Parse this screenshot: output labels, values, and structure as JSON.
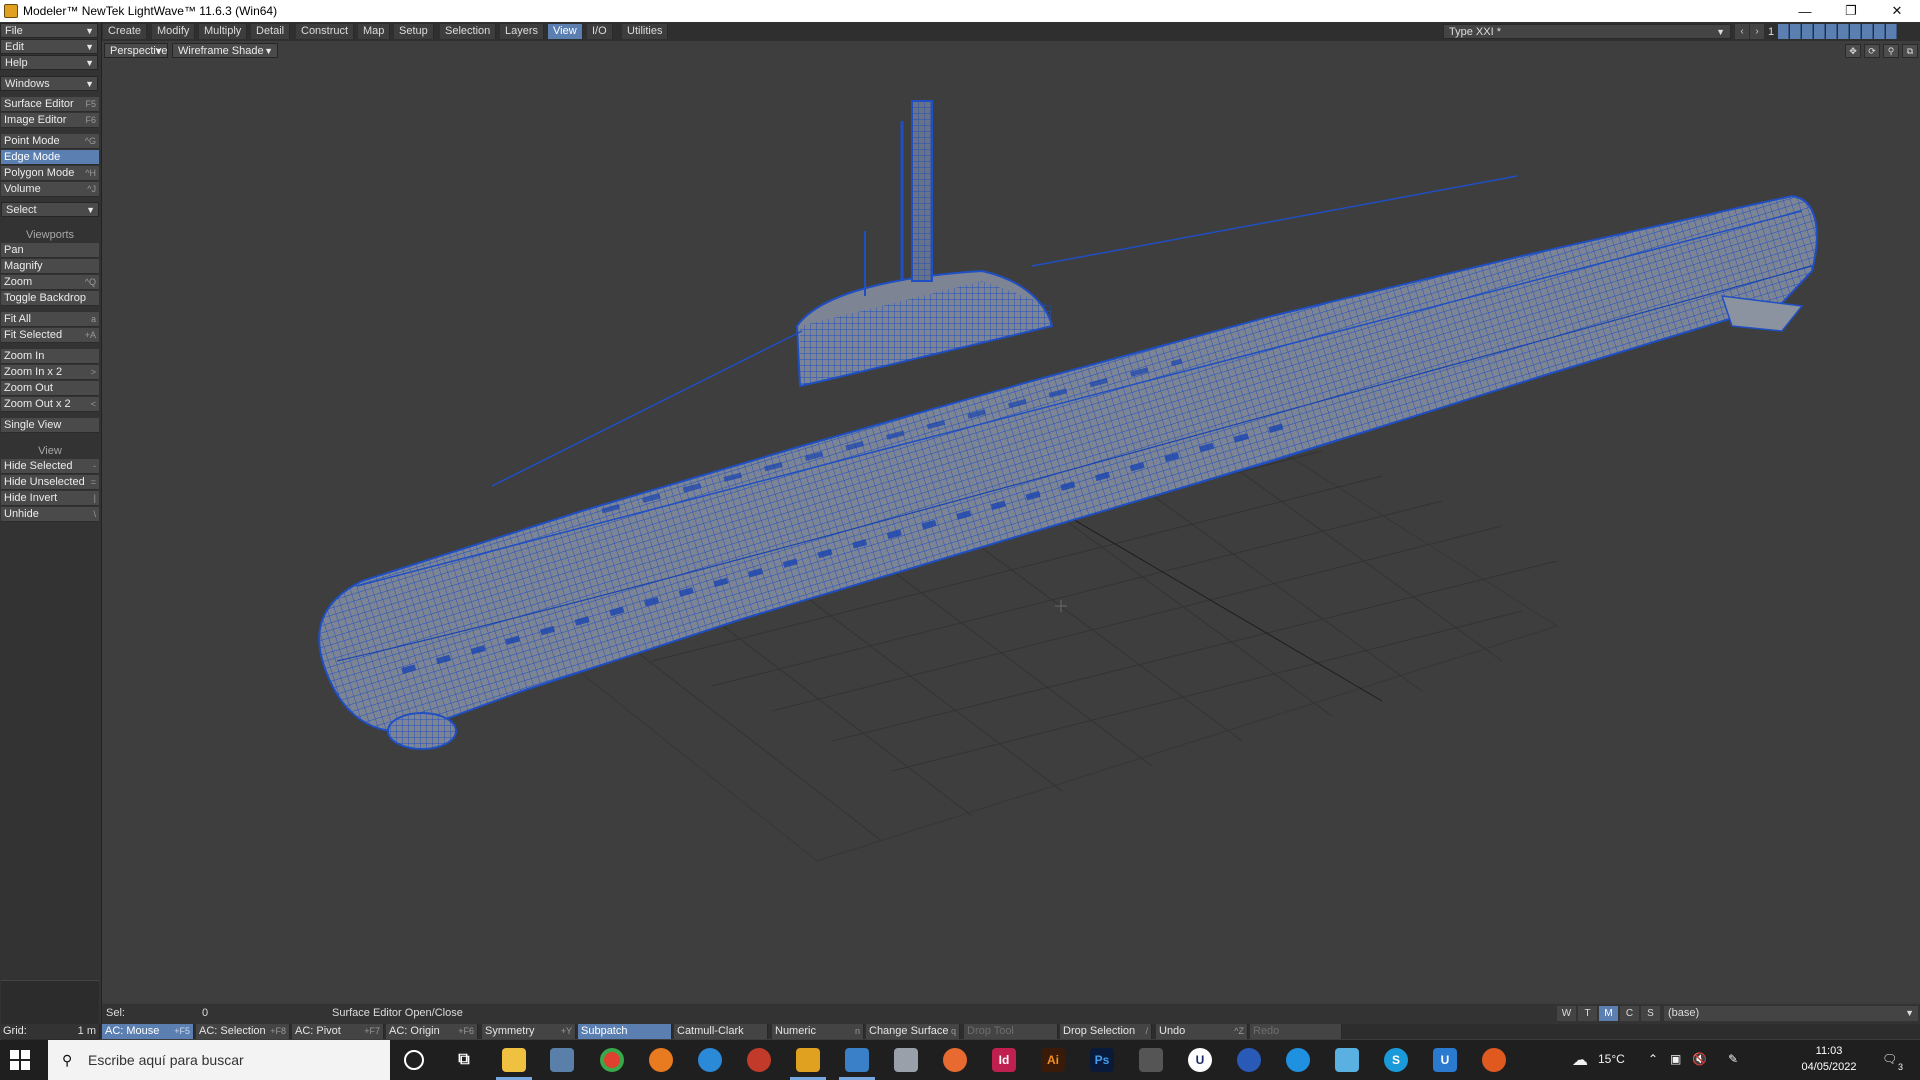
{
  "window": {
    "title": "Modeler™ NewTek LightWave™ 11.6.3 (Win64)",
    "minimize": "—",
    "maximize": "❐",
    "close": "✕"
  },
  "menus": {
    "file": "File",
    "edit": "Edit",
    "help": "Help",
    "windows": "Windows"
  },
  "tabs": [
    "Create",
    "Modify",
    "Multiply",
    "Detail",
    "Construct",
    "Map",
    "Setup",
    "Selection",
    "Layers",
    "View",
    "I/O",
    "Utilities"
  ],
  "active_tab": "View",
  "viewport": {
    "view_type": "Perspective",
    "render_mode": "Wireframe Shade"
  },
  "layers": {
    "object_name": "Type XXI *",
    "layer_number": "1"
  },
  "sidebar": {
    "surface_editor": "Surface Editor",
    "surface_editor_key": "F5",
    "image_editor": "Image Editor",
    "image_editor_key": "F6",
    "point_mode": "Point Mode",
    "point_mode_key": "^G",
    "edge_mode": "Edge Mode",
    "polygon_mode": "Polygon Mode",
    "polygon_mode_key": "^H",
    "volume": "Volume",
    "volume_key": "^J",
    "select": "Select",
    "viewports_head": "Viewports",
    "pan": "Pan",
    "magnify": "Magnify",
    "zoom": "Zoom",
    "zoom_key": "^Q",
    "toggle_backdrop": "Toggle Backdrop",
    "fit_all": "Fit All",
    "fit_all_key": "a",
    "fit_selected": "Fit Selected",
    "fit_selected_key": "+A",
    "zoom_in": "Zoom In",
    "zoom_in_x2": "Zoom In x 2",
    "zoom_in_x2_key": ">",
    "zoom_out": "Zoom Out",
    "zoom_out_x2": "Zoom Out x 2",
    "zoom_out_x2_key": "<",
    "single_view": "Single View",
    "view_head": "View",
    "hide_selected": "Hide Selected",
    "hide_selected_key": "-",
    "hide_unselected": "Hide Unselected",
    "hide_unselected_key": "=",
    "hide_invert": "Hide Invert",
    "hide_invert_key": "|",
    "unhide": "Unhide",
    "unhide_key": "\\"
  },
  "status": {
    "sel_label": "Sel:",
    "sel_value": "0",
    "message": "Surface Editor Open/Close",
    "wtmcs": [
      "W",
      "T",
      "M",
      "C",
      "S"
    ],
    "wtmcs_active": "M",
    "base": "(base)"
  },
  "toolbar": {
    "grid_label": "Grid:",
    "grid_value": "1 m",
    "ac_mouse": "AC: Mouse",
    "ac_mouse_key": "+F5",
    "ac_selection": "AC: Selection",
    "ac_selection_key": "+F8",
    "ac_pivot": "AC: Pivot",
    "ac_pivot_key": "+F7",
    "ac_origin": "AC: Origin",
    "ac_origin_key": "+F6",
    "symmetry": "Symmetry",
    "symmetry_key": "+Y",
    "subpatch": "Subpatch",
    "catmull_clark": "Catmull-Clark",
    "numeric": "Numeric",
    "numeric_key": "n",
    "change_surface": "Change Surface",
    "change_surface_key": "q",
    "drop_tool": "Drop Tool",
    "drop_selection": "Drop Selection",
    "drop_selection_key": "/",
    "undo": "Undo",
    "undo_key": "^Z",
    "redo": "Redo"
  },
  "taskbar": {
    "search_placeholder": "Escribe aquí para buscar",
    "temperature": "15°C",
    "time": "11:03",
    "date": "04/05/2022",
    "notifications": "3"
  },
  "colors": {
    "accent": "#5b7fb0",
    "wire": "#1f4fc2",
    "viewport_bg": "#3e3e3e"
  }
}
